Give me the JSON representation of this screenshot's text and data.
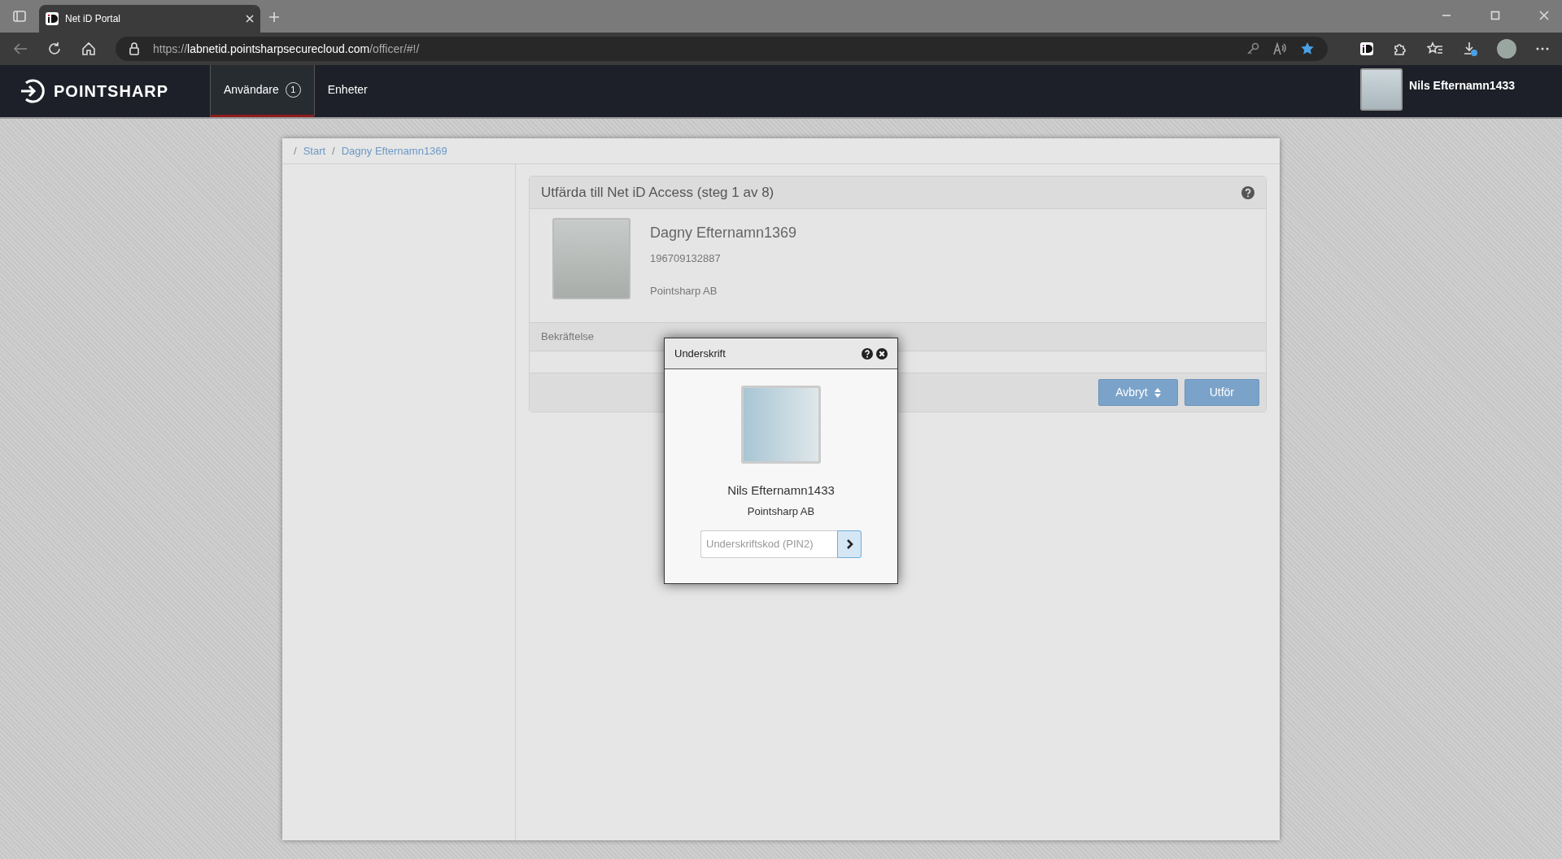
{
  "browser": {
    "tab_title": "Net iD Portal",
    "url": {
      "scheme": "https://",
      "host": "labnetid.pointsharpsecurecloud.com",
      "path": "/officer/#!/"
    }
  },
  "app_nav": {
    "logo": "POINTSHARP",
    "tabs": [
      {
        "label": "Användare",
        "badge": "1",
        "selected": true
      },
      {
        "label": "Enheter",
        "selected": false
      }
    ],
    "user_name": "Nils Efternamn1433"
  },
  "breadcrumb": [
    {
      "separator": "/",
      "label": "Start"
    },
    {
      "separator": "/",
      "label": "Dagny Efternamn1369"
    }
  ],
  "panel": {
    "title": "Utfärda till Net iD Access (steg 1 av 8)",
    "person": {
      "name": "Dagny Efternamn1369",
      "id_number": "196709132887",
      "organization": "Pointsharp AB"
    },
    "section": "Bekräftelse",
    "buttons": [
      {
        "label": "Avbryt",
        "kind": "dropdown"
      },
      {
        "label": "Utför",
        "kind": "plain"
      }
    ]
  },
  "dialog": {
    "title": "Underskrift",
    "signer_name": "Nils Efternamn1433",
    "organization": "Pointsharp AB",
    "pin_field": {
      "placeholder": "Underskriftskod (PIN2)"
    }
  }
}
